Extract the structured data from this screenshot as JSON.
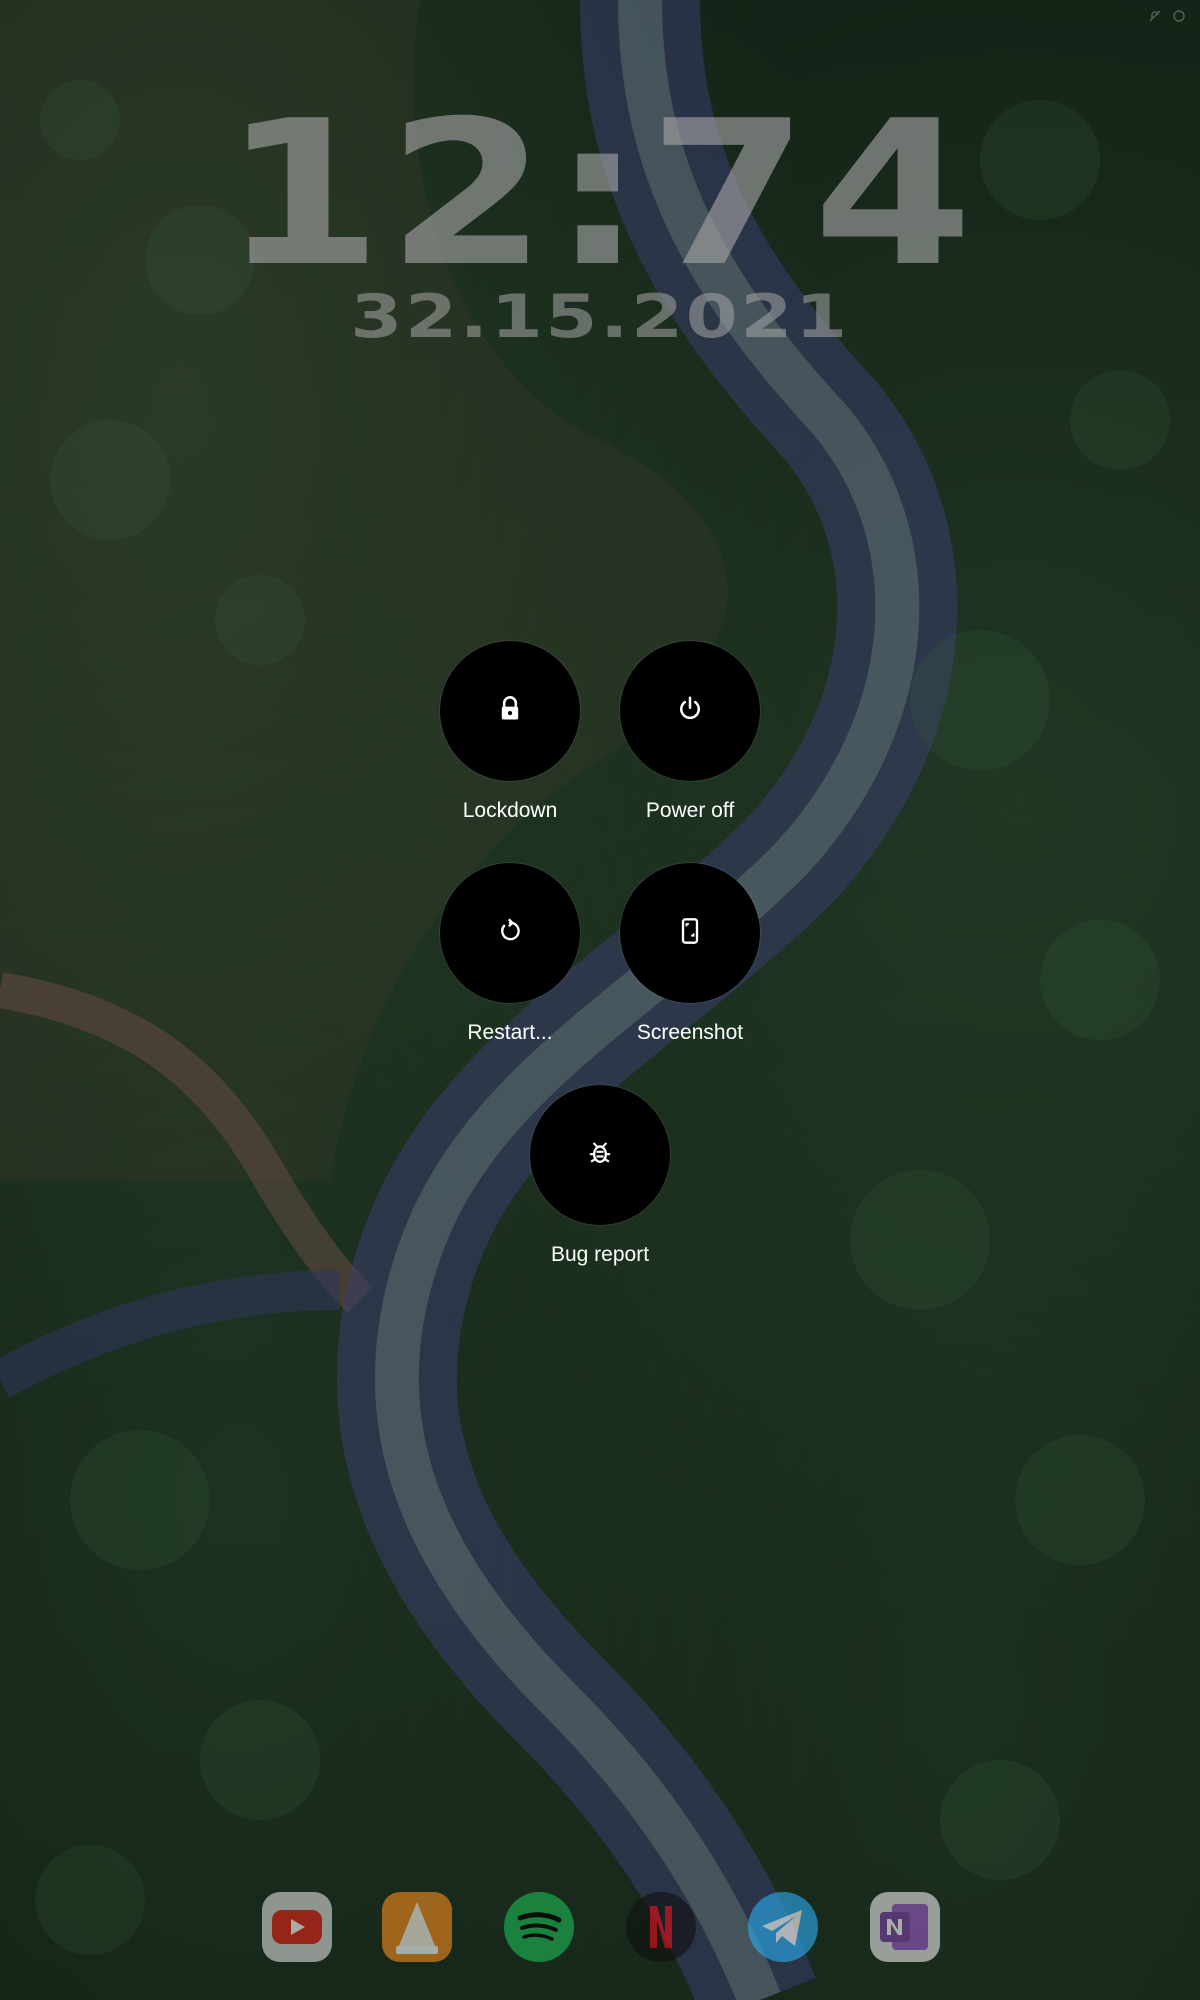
{
  "lockscreen": {
    "time": "12:74",
    "date": "32.15.2021"
  },
  "power_menu": {
    "actions": [
      {
        "label": "Lockdown",
        "icon": "lock-icon"
      },
      {
        "label": "Power off",
        "icon": "power-icon"
      },
      {
        "label": "Restart...",
        "icon": "restart-icon"
      },
      {
        "label": "Screenshot",
        "icon": "screenshot-icon"
      },
      {
        "label": "Bug report",
        "icon": "bug-icon"
      }
    ]
  },
  "dock": {
    "apps": [
      {
        "icon": "youtube-icon",
        "color": "#d8d8d8"
      },
      {
        "icon": "vlc-icon",
        "color": "#f08a1c"
      },
      {
        "icon": "spotify-icon",
        "color": "#1db954"
      },
      {
        "icon": "netflix-icon",
        "color": "#e50914"
      },
      {
        "icon": "telegram-icon",
        "color": "#2aabee"
      },
      {
        "icon": "onenote-icon",
        "color": "#7a3ea6"
      }
    ]
  },
  "status_bar": {
    "icons": [
      "notification-muted-icon",
      "settings-dot-icon"
    ]
  }
}
